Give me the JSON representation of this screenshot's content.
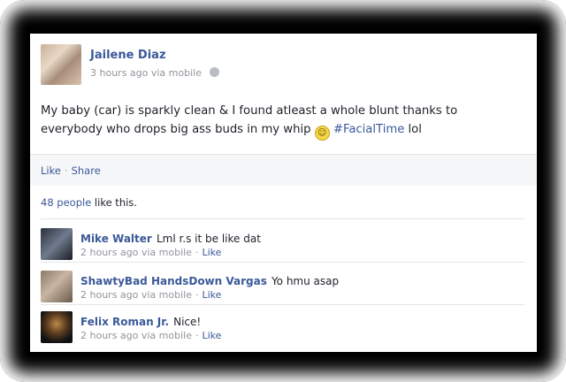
{
  "post": {
    "author": "Jailene Diaz",
    "meta": "3 hours ago via mobile",
    "text_before": "My baby (car) is sparkly clean & I found atleast a whole blunt thanks to everybody who drops big ass buds in my whip",
    "hashtag": "#FacialTime",
    "text_after": " lol"
  },
  "actions": {
    "like": "Like",
    "share": "Share",
    "separator": "·"
  },
  "likes": {
    "count": "48 people",
    "suffix": " like this."
  },
  "comments": [
    {
      "name": "Mike Walter",
      "text": "Lml r.s it be like dat",
      "meta": "2 hours ago via mobile",
      "like": "Like"
    },
    {
      "name": "ShawtyBad HandsDown Vargas",
      "text": "Yo hmu asap",
      "meta": "2 hours ago via mobile",
      "like": "Like"
    },
    {
      "name": "Felix Roman Jr.",
      "text": "Nice!",
      "meta": "2 hours ago via mobile",
      "like": "Like"
    }
  ]
}
